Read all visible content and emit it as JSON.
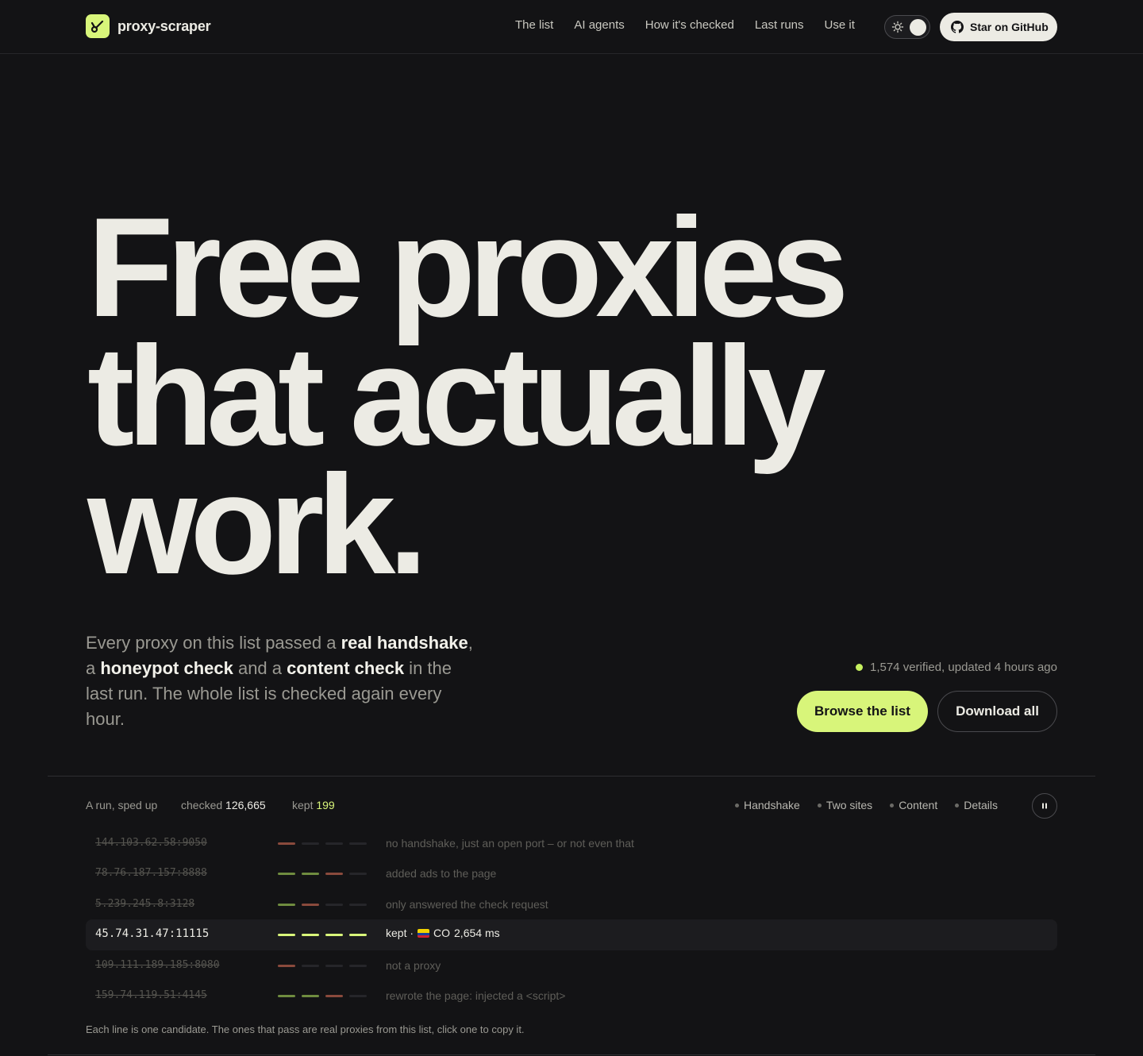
{
  "brand": {
    "name": "proxy-scraper"
  },
  "nav": {
    "links": [
      "The list",
      "AI agents",
      "How it's checked",
      "Last runs",
      "Use it"
    ],
    "github_label": "Star on GitHub"
  },
  "hero": {
    "title_lines": [
      "Free proxies",
      "that actually",
      "work."
    ],
    "copy": {
      "p1": "Every proxy on this list passed a ",
      "b1": "real handshake",
      "p2": ", a ",
      "b2": "honeypot check",
      "p3": " and a ",
      "b3": "content check",
      "p4": " in the last run. The whole list is checked again every hour."
    },
    "status": "1,574 verified, updated 4 hours ago",
    "primary_button": "Browse the list",
    "secondary_button": "Download all"
  },
  "run": {
    "label": "A run, sped up",
    "checked_label": "checked",
    "checked_value": "126,665",
    "kept_label": "kept",
    "kept_value": "199",
    "legend": [
      "Handshake",
      "Two sites",
      "Content",
      "Details"
    ],
    "rows": [
      {
        "address": "144.103.62.58:9050",
        "stages": [
          "fail",
          "none",
          "none",
          "none"
        ],
        "message": "no handshake, just an open port – or not even that",
        "kept": false
      },
      {
        "address": "78.76.187.157:8888",
        "stages": [
          "pass",
          "pass",
          "fail",
          "none"
        ],
        "message": "added ads to the page",
        "kept": false
      },
      {
        "address": "5.239.245.8:3128",
        "stages": [
          "pass",
          "fail",
          "none",
          "none"
        ],
        "message": "only answered the check request",
        "kept": false
      },
      {
        "address": "45.74.31.47:11115",
        "stages": [
          "kept",
          "kept",
          "kept",
          "kept"
        ],
        "message": "kept · ",
        "country": "CO",
        "latency": "2,654 ms",
        "kept": true
      },
      {
        "address": "109.111.189.185:8080",
        "stages": [
          "fail",
          "none",
          "none",
          "none"
        ],
        "message": "not a proxy",
        "kept": false
      },
      {
        "address": "159.74.119.51:4145",
        "stages": [
          "pass",
          "pass",
          "fail",
          "none"
        ],
        "message": "rewrote the page: injected a <script>",
        "kept": false
      }
    ],
    "footnote": "Each line is one candidate. The ones that pass are real proxies from this list, click one to copy it."
  },
  "colors": {
    "accent": "#d8f57a",
    "background": "#131315",
    "text": "#ecebe4",
    "fail": "#8a4a3c",
    "pass": "#6f8c3f"
  }
}
